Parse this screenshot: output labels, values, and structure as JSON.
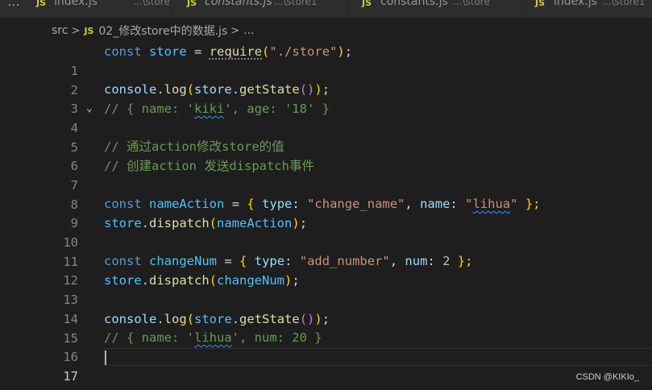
{
  "tabs": [
    {
      "name": "index.js",
      "path": "...\\store",
      "italic": false
    },
    {
      "name": "constants.js",
      "path": "...\\store1",
      "italic": true
    },
    {
      "name": "constants.js",
      "path": "...\\store",
      "italic": false
    },
    {
      "name": "index.js",
      "path": "...\\store1",
      "italic": false
    }
  ],
  "tab_icon_label": "JS",
  "overflow_label": "...",
  "breadcrumb": {
    "folder": "src",
    "sep": ">",
    "file_icon": "JS",
    "file": "02_修改store中的数据.js",
    "sep2": ">",
    "more": "..."
  },
  "gutter": {
    "line_numbers": [
      "1",
      "2",
      "3",
      "4",
      "5",
      "6",
      "7",
      "8",
      "9",
      "10",
      "11",
      "12",
      "13",
      "14",
      "15",
      "16",
      "17"
    ],
    "active_line": "17",
    "fold_icon": "chevron-down-icon"
  },
  "code": {
    "l1": {
      "t1": "const",
      "t2": "store",
      "t3": "=",
      "t4": "require",
      "t5": "(",
      "t6": "\"./store\"",
      "t7": ")",
      "t8": ";"
    },
    "l3": {
      "t1": "console",
      "t2": ".",
      "t3": "log",
      "t4": "(",
      "t5": "store",
      "t6": ".",
      "t7": "getState",
      "t8": "()",
      "t9": ")",
      "t10": ";"
    },
    "l4": {
      "t1": "// { name: '",
      "t2": "kiki",
      "t3": "', age: '18' }"
    },
    "l6": "// 通过action修改store的值",
    "l7": "// 创建action 发送dispatch事件",
    "l9": {
      "t1": "const",
      "t2": "nameAction",
      "t3": "=",
      "t4": "{",
      "t5": "type",
      "t6": ":",
      "t7": "\"change_name\"",
      "t8": ",",
      "t9": "name",
      "t10": ":",
      "t11": "\"",
      "t12": "lihua",
      "t13": "\"",
      "t14": "};"
    },
    "l10": {
      "t1": "store",
      "t2": ".",
      "t3": "dispatch",
      "t4": "(",
      "t5": "nameAction",
      "t6": ")",
      "t7": ";"
    },
    "l12": {
      "t1": "const",
      "t2": "changeNum",
      "t3": "=",
      "t4": "{",
      "t5": "type",
      "t6": ":",
      "t7": "\"add_number\"",
      "t8": ",",
      "t9": "num",
      "t10": ":",
      "t11": "2",
      "t12": "};"
    },
    "l13": {
      "t1": "store",
      "t2": ".",
      "t3": "dispatch",
      "t4": "(",
      "t5": "changeNum",
      "t6": ")",
      "t7": ";"
    },
    "l15": {
      "t1": "console",
      "t2": ".",
      "t3": "log",
      "t4": "(",
      "t5": "store",
      "t6": ".",
      "t7": "getState",
      "t8": "()",
      "t9": ")",
      "t10": ";"
    },
    "l16": {
      "t1": "// { name: '",
      "t2": "lihua",
      "t3": "', num: 20 }"
    }
  },
  "watermark": "CSDN @KIKIo_",
  "colors": {
    "background": "#1e1e1e",
    "keyword": "#569cd6",
    "variable": "#4fc1ff",
    "property": "#9cdcfe",
    "function": "#dcdcaa",
    "string": "#ce9178",
    "number": "#b5cea8",
    "comment": "#6a9955",
    "js_icon": "#cbcb41"
  }
}
